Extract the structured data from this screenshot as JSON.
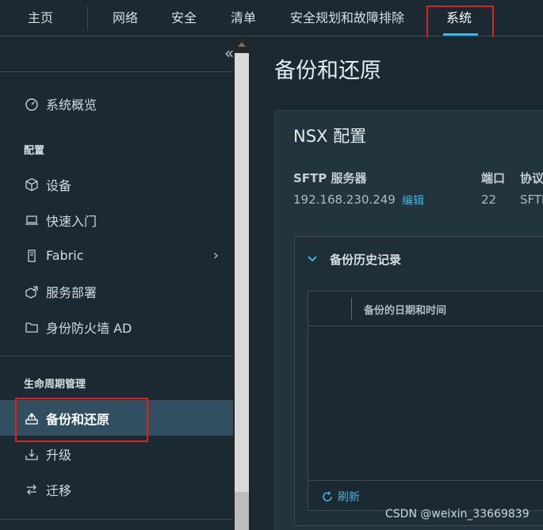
{
  "topnav": {
    "items": [
      "主页",
      "网络",
      "安全",
      "清单",
      "安全规划和故障排除",
      "系统"
    ],
    "active": "系统"
  },
  "sidebar": {
    "collapse_icon": "«",
    "overview": "系统概览",
    "section_config": "配置",
    "config_items": [
      "设备",
      "快速入门",
      "Fabric",
      "服务部署",
      "身份防火墙 AD"
    ],
    "section_lifecycle": "生命周期管理",
    "lifecycle_items": [
      "备份和还原",
      "升级",
      "迁移"
    ]
  },
  "main": {
    "title": "备份和还原",
    "card_title": "NSX 配置",
    "sftp_label": "SFTP 服务器",
    "sftp_value": "192.168.230.249",
    "edit_link": "编辑",
    "port_label": "端口",
    "port_value": "22",
    "protocol_label": "协议",
    "protocol_value": "SFTP",
    "history_title": "备份历史记录",
    "grid_column": "备份的日期和时间",
    "refresh": "刷新"
  },
  "watermark": "CSDN @weixin_33669839",
  "colors": {
    "accent": "#49afd9",
    "highlight_box": "#e02020",
    "active_bg": "#324f62"
  }
}
